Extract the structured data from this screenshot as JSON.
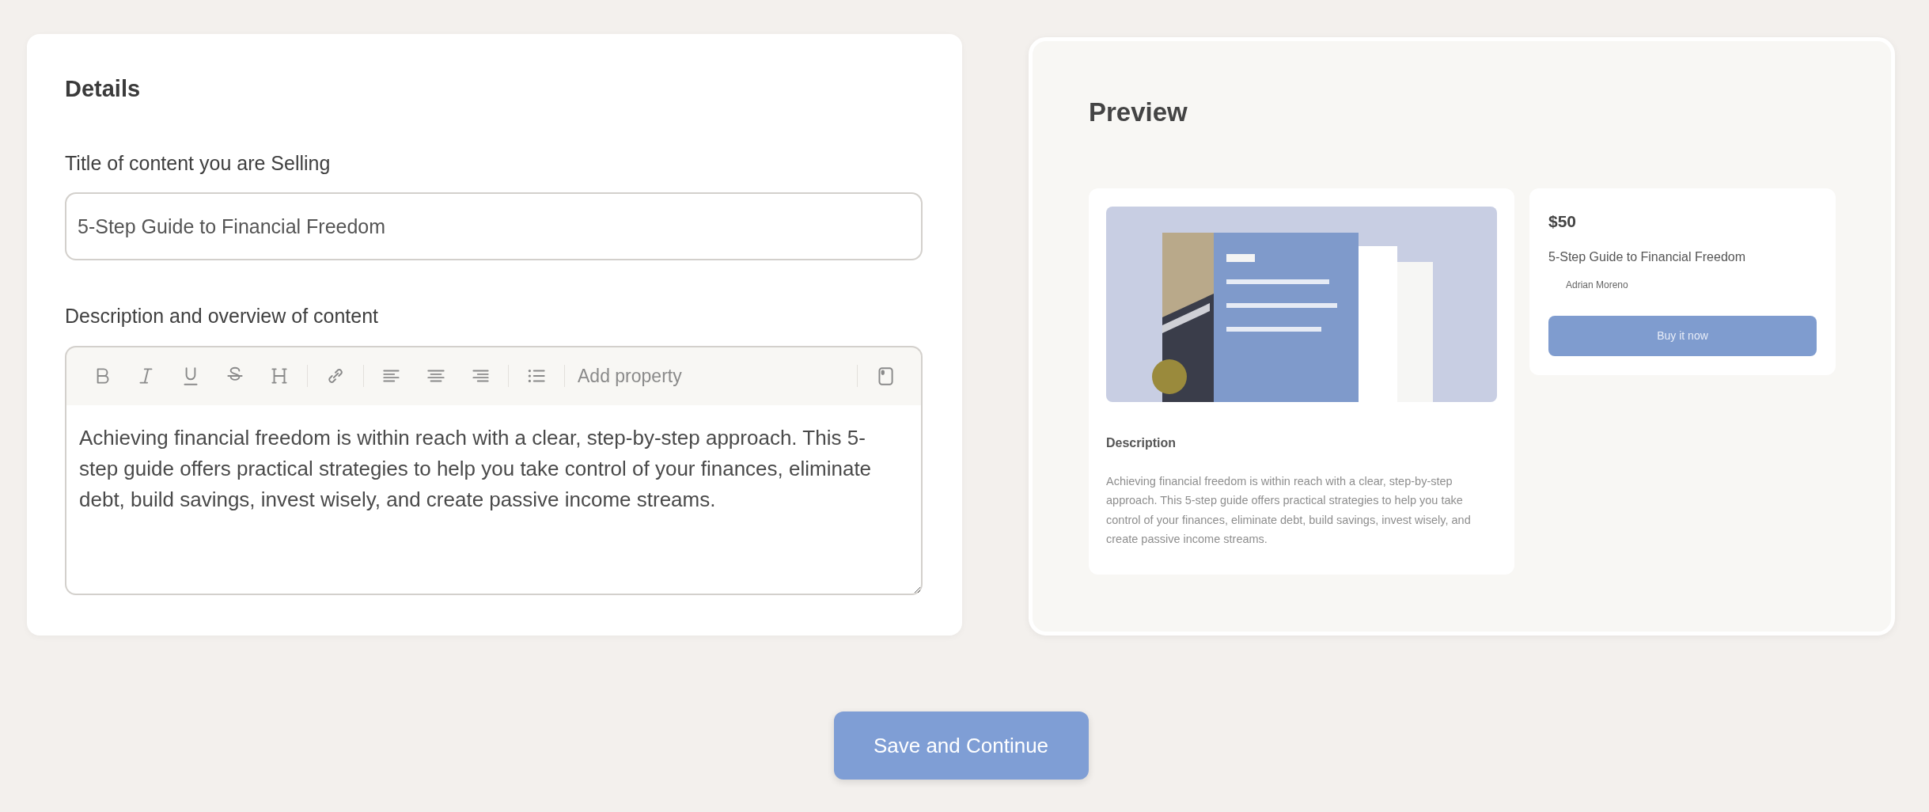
{
  "details": {
    "title": "Details",
    "title_field": {
      "label": "Title of content you are Selling",
      "value": "5-Step Guide to Financial Freedom"
    },
    "description_field": {
      "label": "Description and overview of content",
      "add_property": "Add property",
      "value": "Achieving financial freedom is within reach with a clear, step-by-step approach. This 5-step guide offers practical strategies to help you take control of your finances, eliminate debt, build savings, invest wisely, and create passive income streams."
    }
  },
  "preview": {
    "title": "Preview",
    "description_heading": "Description",
    "description": "Achieving financial freedom is within reach with a clear, step-by-step approach. This 5-step guide offers practical strategies to help you take control of your finances, eliminate debt, build savings, invest wisely, and create passive income streams.",
    "price": "$50",
    "product_title": "5-Step Guide to Financial Freedom",
    "author": "Adrian Moreno",
    "buy_button": "Buy it now"
  },
  "save_button": "Save and Continue"
}
